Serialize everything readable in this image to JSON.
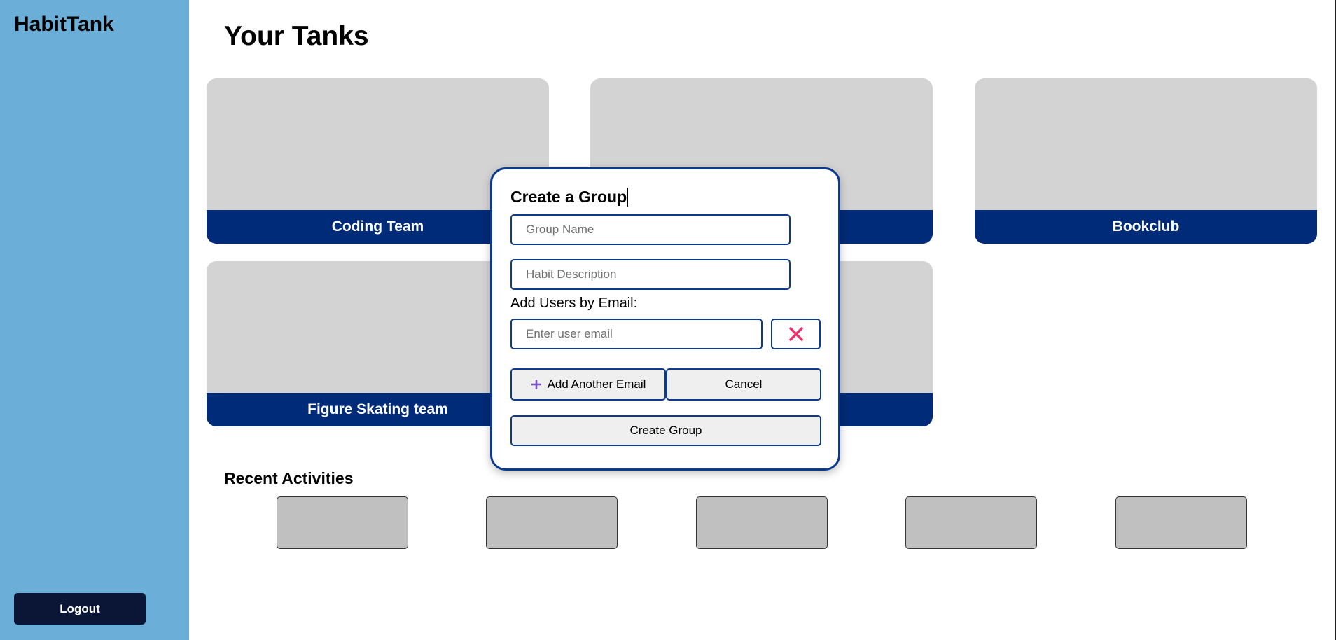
{
  "app": {
    "name": "HabitTank"
  },
  "sidebar": {
    "logout_label": "Logout"
  },
  "main": {
    "title": "Your Tanks",
    "tanks": [
      {
        "label": "Coding Team"
      },
      {
        "label": ""
      },
      {
        "label": "Bookclub"
      },
      {
        "label": "Figure Skating team"
      },
      {
        "label": ""
      }
    ],
    "recent_title": "Recent Activities"
  },
  "modal": {
    "title": "Create a Group",
    "group_name": {
      "value": "",
      "placeholder": "Group Name"
    },
    "habit_description": {
      "value": "",
      "placeholder": "Habit Description"
    },
    "users_label": "Add Users by Email:",
    "email": {
      "value": "",
      "placeholder": "Enter user email"
    },
    "add_email_label": "Add Another Email",
    "cancel_label": "Cancel",
    "create_label": "Create Group",
    "accent": "#0c3a8c",
    "remove_color": "#e8336b",
    "plus_color": "#7a52c7"
  },
  "colors": {
    "sidebar": "#6baed8",
    "tank_label_bg": "#002b78",
    "tank_bg": "#d3d3d3",
    "logout_bg": "#0b1636"
  }
}
